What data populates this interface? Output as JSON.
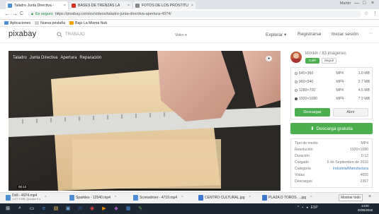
{
  "browser": {
    "tabs": [
      {
        "label": "Taladro Junta Directiva - ",
        "active": true,
        "color": "#4b8fd6"
      },
      {
        "label": "BASES DE TRENZAS LA",
        "active": false,
        "color": "#d93025"
      },
      {
        "label": "FOTOS DE LOS PROSTITU",
        "active": false,
        "color": "#888888"
      }
    ],
    "user": "Martin",
    "controls": [
      "—",
      "□",
      "×"
    ],
    "secure_label": "Es seguro",
    "url": "https://pixabay.com/es/videos/taladro-junta-directiva-apertura-4974/",
    "bookmarks": [
      {
        "label": "Aplicaciones",
        "color": "#4b8fd6"
      },
      {
        "label": "Nueva pestaña",
        "color": "#cccccc"
      },
      {
        "label": "Bajo La Misma Nub",
        "color": "#f4a300"
      }
    ]
  },
  "header": {
    "logo": "pixabay",
    "search_placeholder": "TRABAJO",
    "scope": "Video ▾",
    "nav": {
      "explorar": "Explorar ▾",
      "registrarse": "Registrarse",
      "login": "Iniciar sesión",
      "more": "···"
    }
  },
  "video": {
    "tags": [
      "Taladro",
      "Junta Directiva",
      "Apertura",
      "Reparación"
    ],
    "time": "00:12"
  },
  "panel": {
    "author": "klimkin / 83 imágenes",
    "follow": "Café",
    "seguir": "Seguir",
    "options": [
      {
        "res": "640×360",
        "fmt": "MP4",
        "size": "1.0 MB",
        "selected": false
      },
      {
        "res": "960×540",
        "fmt": "MP4",
        "size": "2.7 MB",
        "selected": false
      },
      {
        "res": "1280×720",
        "fmt": "MP4",
        "size": "4.5 MB",
        "selected": false
      },
      {
        "res": "1920×1080",
        "fmt": "MP4",
        "size": "7.9 MB",
        "selected": true
      }
    ],
    "btn_download": "Descargar",
    "btn_open": "Abrir",
    "free_download": "Descarga gratuita",
    "info": [
      {
        "k": "Tipo de medio",
        "v": "MP4",
        "link": false
      },
      {
        "k": "Resolución",
        "v": "1920×1080",
        "link": false
      },
      {
        "k": "Duración",
        "v": "0:12",
        "link": false
      },
      {
        "k": "Cargado",
        "v": "6 de Septiembre de 2016",
        "link": false
      },
      {
        "k": "Categoría",
        "v": "Industria/Manufactura",
        "link": true
      },
      {
        "k": "Vistas",
        "v": "4655",
        "link": false
      },
      {
        "k": "Descargas",
        "v": "2367",
        "link": false
      }
    ]
  },
  "downloads": [
    {
      "name": "Drill - 4974.mp4",
      "sub": "1.0/7.9 MB, Quedan 5 s",
      "color": "#4b8fd6"
    },
    {
      "name": "Sparkles - 12540.mp4",
      "sub": "",
      "color": "#4b8fd6"
    },
    {
      "name": "Screwdriver - 4719.mp4",
      "sub": "",
      "color": "#4b8fd6"
    },
    {
      "name": "CENTRO CULTURAL.jpg",
      "sub": "",
      "color": "#3d7ad6"
    },
    {
      "name": "PLAZA D TOROS ....jpg",
      "sub": "",
      "color": "#3d7ad6"
    }
  ],
  "show_all": "Mostrar todo",
  "taskbar": {
    "icons": [
      "windows-start-icon",
      "search-icon",
      "task-view-icon",
      "edge-icon",
      "explorer-icon",
      "store-icon",
      "word-icon",
      "chrome-icon",
      "media-icon",
      "app-icon",
      "photos-icon",
      "paint-icon"
    ],
    "tray": "ESP",
    "time": "14:00",
    "date": "20/05/2018"
  }
}
